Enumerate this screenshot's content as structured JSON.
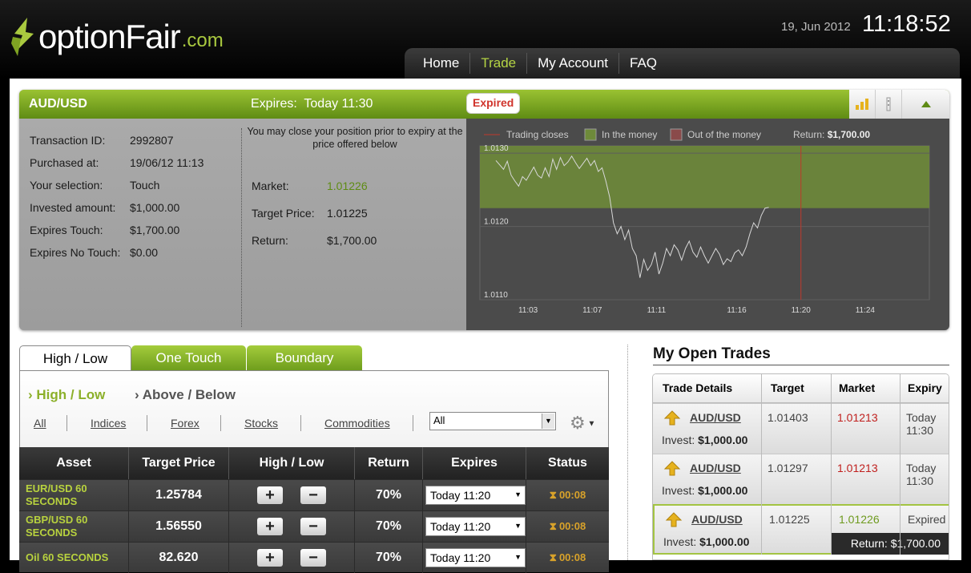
{
  "header": {
    "logo_text": "optionFair",
    "logo_suffix": ".com",
    "date": "19, Jun 2012",
    "clock": "11:18:52",
    "nav": [
      "Home",
      "Trade",
      "My Account",
      "FAQ"
    ],
    "nav_active": "Trade"
  },
  "position": {
    "asset": "AUD/USD",
    "expires_label": "Expires:",
    "expires_value": "Today 11:30",
    "status_badge": "Expired",
    "details": [
      {
        "label": "Transaction ID:",
        "value": "2992807"
      },
      {
        "label": "Purchased at:",
        "value": "19/06/12 11:13"
      },
      {
        "label": "Your selection:",
        "value": "Touch"
      },
      {
        "label": "Invested amount:",
        "value": "$1,000.00"
      },
      {
        "label": "Expires Touch:",
        "value": "$1,700.00"
      },
      {
        "label": "Expires No Touch:",
        "value": "$0.00"
      }
    ],
    "close_note": "You may close your position prior to expiry at the price offered below",
    "market_label": "Market:",
    "market_value": "1.01226",
    "target_label": "Target Price:",
    "target_value": "1.01225",
    "return_label": "Return:",
    "return_value": "$1,700.00"
  },
  "chart_data": {
    "type": "line",
    "title": "",
    "legend": [
      "Trading closes",
      "In the money",
      "Out of the money"
    ],
    "return_label": "Return:",
    "return_value": "$1,700.00",
    "x_ticks": [
      "11:03",
      "11:07",
      "11:11",
      "11:16",
      "11:20",
      "11:24"
    ],
    "y_ticks": [
      "1.0130",
      "1.0120",
      "1.0110"
    ],
    "ylim": [
      1.011,
      1.0131
    ],
    "in_the_money_above": 1.01225,
    "trading_closes_at": "11:20",
    "colors": {
      "line": "#d8d8d8",
      "in_money": "#6e8a3a",
      "out_money": "#8a4a4a",
      "closes": "#c0392b",
      "bg": "#4b4b4b"
    },
    "series": [
      {
        "values": [
          1.0129,
          1.01284,
          1.01278,
          1.01289,
          1.0127,
          1.01262,
          1.01255,
          1.01268,
          1.01263,
          1.01272,
          1.01281,
          1.0127,
          1.01266,
          1.0128,
          1.01268,
          1.01292,
          1.01278,
          1.01294,
          1.01283,
          1.01288,
          1.01296,
          1.01287,
          1.01279,
          1.01286,
          1.01293,
          1.01283,
          1.0129,
          1.01275,
          1.0128,
          1.01262,
          1.0124,
          1.01205,
          1.0119,
          1.012,
          1.01182,
          1.01195,
          1.0117,
          1.0116,
          1.0113,
          1.01155,
          1.0114,
          1.01148,
          1.01165,
          1.01135,
          1.0115,
          1.0117,
          1.0116,
          1.01175,
          1.01168,
          1.01154,
          1.0117,
          1.0118,
          1.01165,
          1.01158,
          1.01172,
          1.0116,
          1.0115,
          1.0116,
          1.0117,
          1.01162,
          1.01148,
          1.01156,
          1.01152,
          1.01164,
          1.01168,
          1.0116,
          1.01172,
          1.0119,
          1.01205,
          1.01198,
          1.01215,
          1.01225,
          1.01226
        ]
      }
    ]
  },
  "trade_tabs": [
    "High / Low",
    "One Touch",
    "Boundary"
  ],
  "trade_tab_active": "High / Low",
  "subtabs": [
    "High / Low",
    "Above / Below"
  ],
  "categories": [
    "All",
    "Indices",
    "Forex",
    "Stocks",
    "Commodities"
  ],
  "filter_select": "All",
  "asset_table": {
    "headers": [
      "Asset",
      "Target Price",
      "High / Low",
      "Return",
      "Expires",
      "Status"
    ],
    "rows": [
      {
        "asset": "EUR/USD 60 SECONDS",
        "target": "1.25784",
        "return": "70%",
        "expires": "Today 11:20",
        "status": "00:08"
      },
      {
        "asset": "GBP/USD 60 SECONDS",
        "target": "1.56550",
        "return": "70%",
        "expires": "Today 11:20",
        "status": "00:08"
      },
      {
        "asset": "Oil 60 SECONDS",
        "target": "82.620",
        "return": "70%",
        "expires": "Today 11:20",
        "status": "00:08"
      }
    ]
  },
  "open_trades": {
    "title": "My Open Trades",
    "headers": [
      "Trade Details",
      "Target",
      "Market",
      "Expiry"
    ],
    "invest_label": "Invest:",
    "rows": [
      {
        "asset": "AUD/USD",
        "invest": "$1,000.00",
        "target": "1.01403",
        "market": "1.01213",
        "market_color": "#c0201e",
        "expiry": "Today 11:30"
      },
      {
        "asset": "AUD/USD",
        "invest": "$1,000.00",
        "target": "1.01297",
        "market": "1.01213",
        "market_color": "#c0201e",
        "expiry": "Today 11:30"
      },
      {
        "asset": "AUD/USD",
        "invest": "$1,000.00",
        "target": "1.01225",
        "market": "1.01226",
        "market_color": "#6e9a1e",
        "expiry": "Expired",
        "return": "Return: $1,700.00"
      }
    ]
  }
}
